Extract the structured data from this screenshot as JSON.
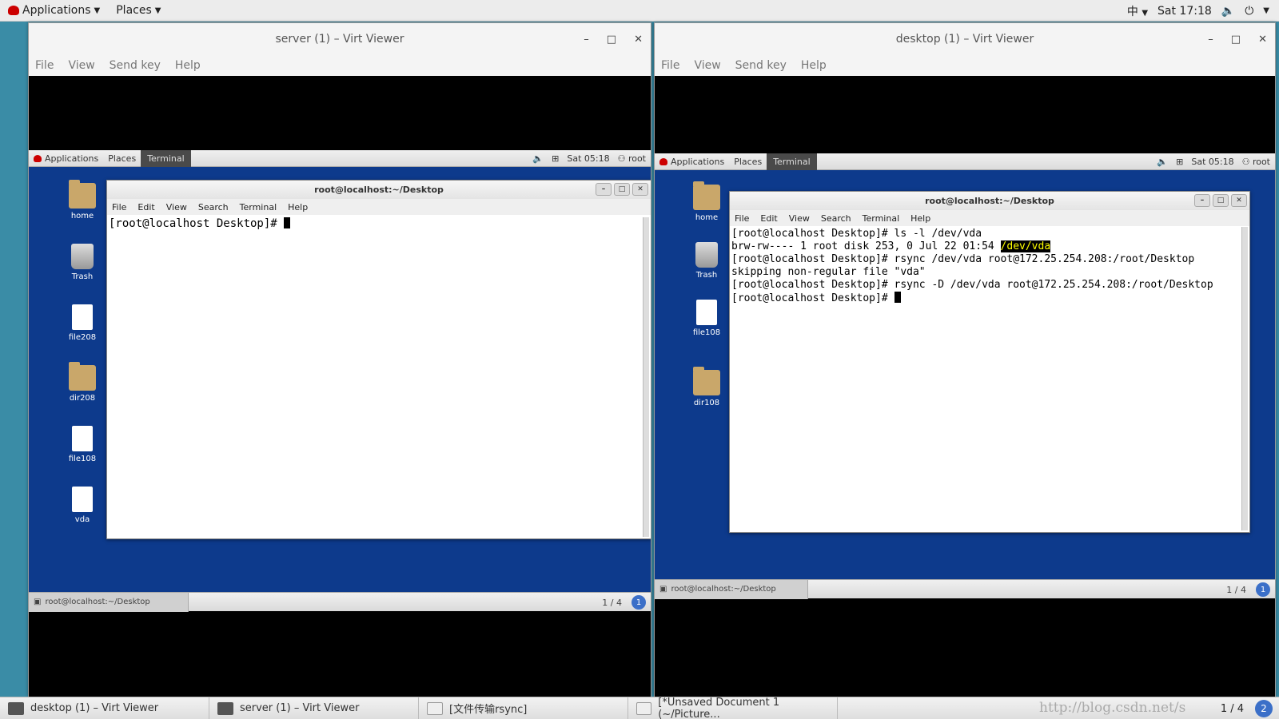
{
  "topbar": {
    "applications": "Applications",
    "places": "Places",
    "input_method": "中",
    "clock": "Sat 17:18"
  },
  "windows": {
    "server": {
      "title": "server (1) – Virt Viewer",
      "menu": [
        "File",
        "View",
        "Send key",
        "Help"
      ],
      "guest_panel": {
        "applications": "Applications",
        "places": "Places",
        "terminal": "Terminal",
        "clock": "Sat 05:18",
        "user": "root"
      },
      "desktop_icons": [
        "home",
        "Trash",
        "file208",
        "dir208",
        "file108",
        "vda"
      ],
      "terminal": {
        "title": "root@localhost:~/Desktop",
        "menu": [
          "File",
          "Edit",
          "View",
          "Search",
          "Terminal",
          "Help"
        ],
        "lines": [
          "[root@localhost Desktop]# "
        ]
      },
      "guest_bottom": {
        "task": "root@localhost:~/Desktop",
        "workspace": "1 / 4",
        "ws_badge": "1"
      }
    },
    "desktop": {
      "title": "desktop (1) – Virt Viewer",
      "menu": [
        "File",
        "View",
        "Send key",
        "Help"
      ],
      "guest_panel": {
        "applications": "Applications",
        "places": "Places",
        "terminal": "Terminal",
        "clock": "Sat 05:18",
        "user": "root"
      },
      "desktop_icons": [
        "home",
        "Trash",
        "file108",
        "dir108"
      ],
      "terminal": {
        "title": "root@localhost:~/Desktop",
        "menu": [
          "File",
          "Edit",
          "View",
          "Search",
          "Terminal",
          "Help"
        ],
        "line1": "[root@localhost Desktop]# ls -l /dev/vda",
        "line2_prefix": "brw-rw---- 1 root disk 253, 0 Jul 22 01:54 ",
        "line2_highlight": "/dev/vda",
        "line3": "[root@localhost Desktop]# rsync /dev/vda root@172.25.254.208:/root/Desktop",
        "line4": "skipping non-regular file \"vda\"",
        "line5": "[root@localhost Desktop]# rsync -D /dev/vda root@172.25.254.208:/root/Desktop",
        "line6": "[root@localhost Desktop]# "
      },
      "guest_bottom": {
        "task": "root@localhost:~/Desktop",
        "workspace": "1 / 4",
        "ws_badge": "1"
      }
    }
  },
  "taskbar": {
    "items": [
      "desktop (1) – Virt Viewer",
      "server (1) – Virt Viewer",
      "[文件传输rsync]",
      "[*Unsaved Document 1 (~/Picture..."
    ],
    "workspace": "1 / 4",
    "ws_badge": "2",
    "watermark": "http://blog.csdn.net/s"
  },
  "colors": {
    "host_desktop": "#3a8ca6",
    "guest_desktop": "#0d3a8c",
    "highlight_bg": "#000000",
    "highlight_fg": "#ffff00"
  }
}
